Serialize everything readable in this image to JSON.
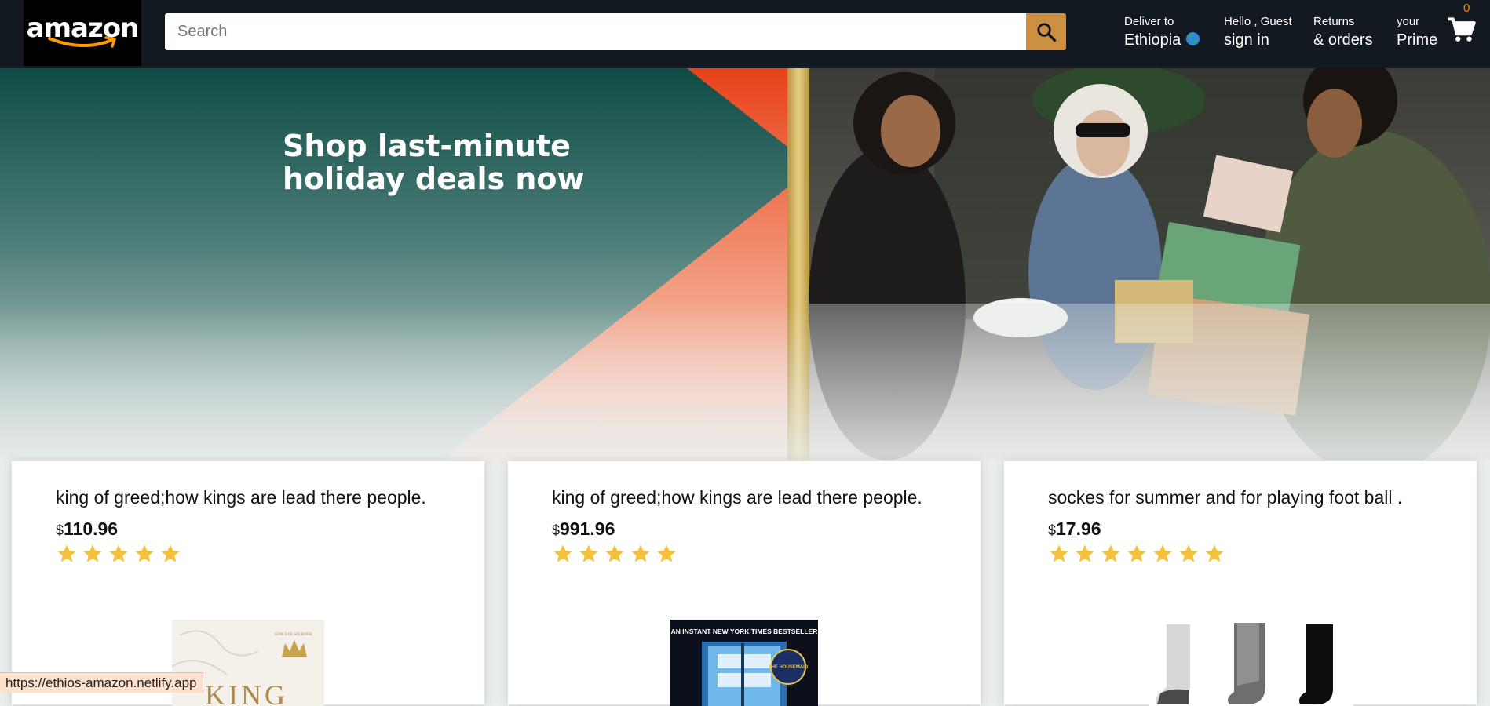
{
  "header": {
    "logo_text": "amazon",
    "search_placeholder": "Search",
    "deliver": {
      "line1": "Deliver to",
      "line2": "Ethiopia"
    },
    "account": {
      "line1": "Hello , Guest",
      "line2": "sign in"
    },
    "returns": {
      "line1": "Returns",
      "line2": "& orders"
    },
    "prime": {
      "line1": "your",
      "line2": "Prime"
    },
    "cart_count": "0"
  },
  "hero": {
    "title_line1": "Shop last-minute",
    "title_line2": "holiday deals now"
  },
  "products": [
    {
      "title": "king of greed;how kings are lead there people.",
      "currency": "$",
      "price": "110.96",
      "rating": 5
    },
    {
      "title": "king of greed;how kings are lead there people.",
      "currency": "$",
      "price": "991.96",
      "rating": 5
    },
    {
      "title": "sockes for summer and for playing foot ball .",
      "currency": "$",
      "price": "17.96",
      "rating": 7
    }
  ],
  "book1_cover": {
    "small": "KINGS OF SIN BOOK",
    "big": "KING"
  },
  "book2_cover": {
    "top": "AN INSTANT NEW YORK TIMES BESTSELLER",
    "badge": "THE HOUSEMAID"
  },
  "status_url": "https://ethios-amazon.netlify.app",
  "colors": {
    "header": "#131921",
    "search_button": "#cd9042",
    "star": "#f5c13d",
    "cart_count": "#f08804"
  }
}
